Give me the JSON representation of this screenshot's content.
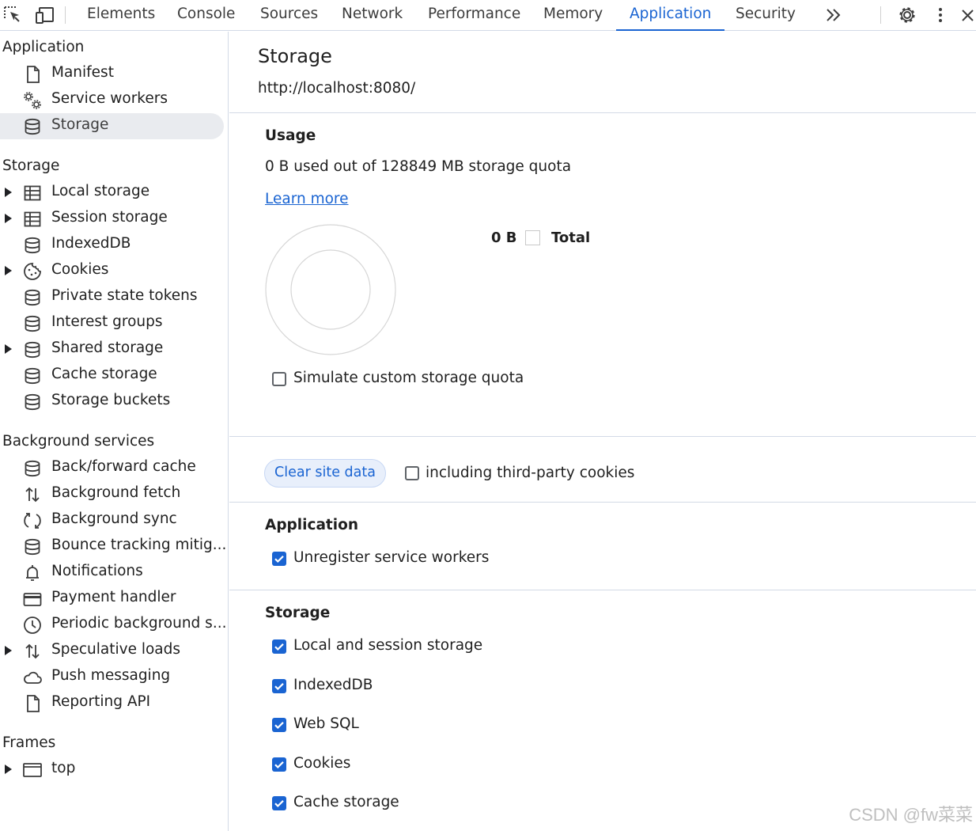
{
  "toolbar": {
    "tabs": [
      "Elements",
      "Console",
      "Sources",
      "Network",
      "Performance",
      "Memory",
      "Application",
      "Security"
    ],
    "active_tab": "Application",
    "icons": [
      "inspect-element-icon",
      "device-toolbar-icon",
      "more-tabs-icon",
      "settings-gear-icon",
      "kebab-menu-icon",
      "close-icon"
    ]
  },
  "sidebar": {
    "application": {
      "title": "Application",
      "items": [
        {
          "label": "Manifest",
          "icon": "document-icon"
        },
        {
          "label": "Service workers",
          "icon": "gears-icon"
        },
        {
          "label": "Storage",
          "icon": "database-icon",
          "selected": true
        }
      ]
    },
    "storage": {
      "title": "Storage",
      "items": [
        {
          "label": "Local storage",
          "icon": "table-icon",
          "expandable": true
        },
        {
          "label": "Session storage",
          "icon": "table-icon",
          "expandable": true
        },
        {
          "label": "IndexedDB",
          "icon": "database-icon"
        },
        {
          "label": "Cookies",
          "icon": "cookie-icon",
          "expandable": true
        },
        {
          "label": "Private state tokens",
          "icon": "database-icon"
        },
        {
          "label": "Interest groups",
          "icon": "database-icon"
        },
        {
          "label": "Shared storage",
          "icon": "database-icon",
          "expandable": true
        },
        {
          "label": "Cache storage",
          "icon": "database-icon"
        },
        {
          "label": "Storage buckets",
          "icon": "database-icon"
        }
      ]
    },
    "background": {
      "title": "Background services",
      "items": [
        {
          "label": "Back/forward cache",
          "icon": "database-icon"
        },
        {
          "label": "Background fetch",
          "icon": "up-down-arrows-icon"
        },
        {
          "label": "Background sync",
          "icon": "sync-icon"
        },
        {
          "label": "Bounce tracking mitig...",
          "icon": "database-icon"
        },
        {
          "label": "Notifications",
          "icon": "bell-icon"
        },
        {
          "label": "Payment handler",
          "icon": "credit-card-icon"
        },
        {
          "label": "Periodic background s...",
          "icon": "clock-icon"
        },
        {
          "label": "Speculative loads",
          "icon": "up-down-arrows-icon",
          "expandable": true
        },
        {
          "label": "Push messaging",
          "icon": "cloud-icon"
        },
        {
          "label": "Reporting API",
          "icon": "document-icon"
        }
      ]
    },
    "frames": {
      "title": "Frames",
      "items": [
        {
          "label": "top",
          "icon": "frame-window-icon",
          "expandable": true
        }
      ]
    }
  },
  "main": {
    "title": "Storage",
    "origin": "http://localhost:8080/",
    "usage": {
      "heading": "Usage",
      "text": "0 B used out of 128849 MB storage quota",
      "learn_more": "Learn more",
      "legend_value": "0 B",
      "legend_label": "Total",
      "used_fraction": 0
    },
    "simulate_quota": {
      "label": "Simulate custom storage quota",
      "checked": false
    },
    "clear_button": "Clear site data",
    "third_party": {
      "label": "including third-party cookies",
      "checked": false
    },
    "application_section": {
      "heading": "Application",
      "options": [
        {
          "label": "Unregister service workers",
          "checked": true
        }
      ]
    },
    "storage_section": {
      "heading": "Storage",
      "options": [
        {
          "label": "Local and session storage",
          "checked": true
        },
        {
          "label": "IndexedDB",
          "checked": true
        },
        {
          "label": "Web SQL",
          "checked": true
        },
        {
          "label": "Cookies",
          "checked": true
        },
        {
          "label": "Cache storage",
          "checked": true
        }
      ]
    }
  },
  "watermark": "CSDN @fw菜菜",
  "colors": {
    "accent": "#1a64d2",
    "border": "#d3dae6",
    "selected_bg": "#e9ebef"
  }
}
